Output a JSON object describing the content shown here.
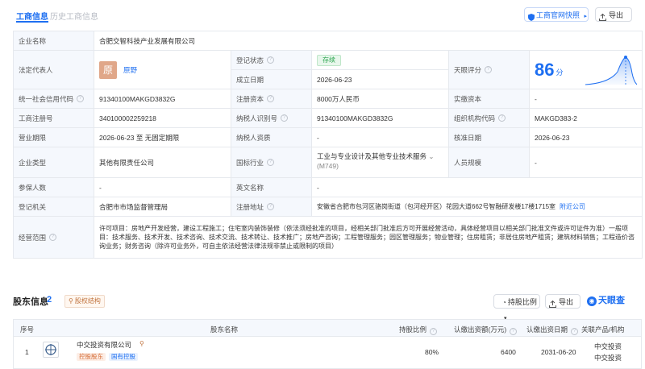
{
  "tabs": {
    "active": "工商信息",
    "inactive": "历史工商信息"
  },
  "toolbar": {
    "snapshot": "工商官网快照",
    "export": "导出"
  },
  "company": {
    "name_label": "企业名称",
    "name": "合肥交智科技产业发展有限公司",
    "legal_rep_label": "法定代表人",
    "legal_rep_avatar": "原",
    "legal_rep": "原野",
    "status_label": "登记状态",
    "status": "存续",
    "established_label": "成立日期",
    "established": "2026-06-23",
    "score_label": "天眼评分",
    "score": "86",
    "score_unit": "分",
    "credit_code_label": "统一社会信用代码",
    "credit_code": "91340100MAKGD3832G",
    "reg_capital_label": "注册资本",
    "reg_capital": "8000万人民币",
    "paid_capital_label": "实缴资本",
    "paid_capital": "-",
    "reg_no_label": "工商注册号",
    "reg_no": "340100002259218",
    "taxpayer_id_label": "纳税人识别号",
    "taxpayer_id": "91340100MAKGD3832G",
    "org_code_label": "组织机构代码",
    "org_code": "MAKGD383-2",
    "term_label": "营业期限",
    "term": "2026-06-23 至 无固定期限",
    "taxpayer_qual_label": "纳税人资质",
    "taxpayer_qual": "-",
    "approved_label": "核准日期",
    "approved": "2026-06-23",
    "type_label": "企业类型",
    "type": "其他有限责任公司",
    "industry_label": "国标行业",
    "industry": "工业与专业设计及其他专业技术服务",
    "industry_code": "(M749)",
    "staff_label": "人员规模",
    "staff": "-",
    "insured_label": "参保人数",
    "insured": "-",
    "english_label": "英文名称",
    "english": "-",
    "authority_label": "登记机关",
    "authority": "合肥市市场监督管理局",
    "address_label": "注册地址",
    "address": "安徽省合肥市包河区骆岗街道（包河经开区）花园大道662号智融研发楼17楼1715室",
    "address_link": "附近公司",
    "scope_label": "经营范围",
    "scope": "许可项目：房地产开发经营，建设工程施工；住宅室内装饰装修（依法须经批准的项目，经相关部门批准后方可开展经营活动，具体经营项目以相关部门批准文件或许可证件为准）一般项目：技术服务、技术开发、技术咨询、技术交流、技术转让、技术推广；房地产咨询；工程管理服务；园区管理服务；物业管理；住房租赁；非居住房地产租赁；建筑材料销售；工程造价咨询业务；财务咨询（除许可业务外，可自主依法经营法律法规非禁止或限制的项目）"
  },
  "shareholders": {
    "title": "股东信息",
    "count": "2",
    "structure_tag": "股权结构",
    "sort_btn": "持股比例",
    "export_btn": "导出",
    "brand": "天眼查",
    "headers": [
      "序号",
      "股东名称",
      "持股比例",
      "认缴出资额(万元)",
      "认缴出资日期",
      "关联产品/机构"
    ],
    "rows": [
      {
        "index": "1",
        "name": "中交投资有限公司",
        "tag1": "控股股东",
        "tag2": "国有控股",
        "ratio": "80%",
        "amount": "6400",
        "date": "2031-06-20",
        "related1": "中交投资",
        "related2": "中交投资"
      }
    ]
  }
}
